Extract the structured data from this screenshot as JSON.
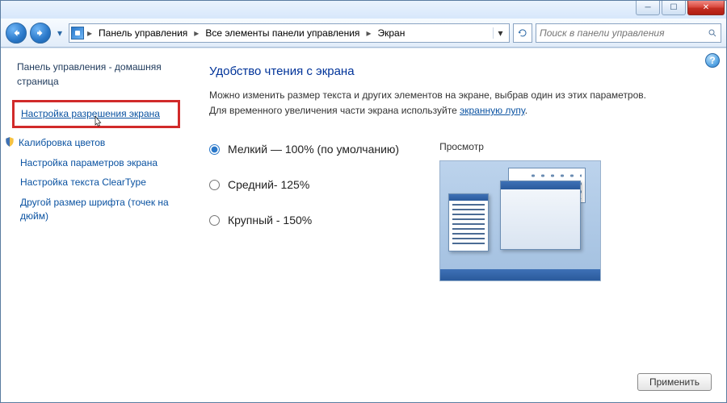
{
  "breadcrumb": {
    "items": [
      "Панель управления",
      "Все элементы панели управления",
      "Экран"
    ]
  },
  "search": {
    "placeholder": "Поиск в панели управления"
  },
  "sidebar": {
    "home": "Панель управления - домашняя страница",
    "items": [
      "Настройка разрешения экрана",
      "Калибровка цветов",
      "Настройка параметров экрана",
      "Настройка текста ClearType",
      "Другой размер шрифта (точек на дюйм)"
    ]
  },
  "content": {
    "heading": "Удобство чтения с экрана",
    "desc_before": "Можно изменить размер текста и других элементов на экране, выбрав один из этих параметров. Для временного увеличения части экрана используйте ",
    "desc_link": "экранную лупу",
    "desc_after": ".",
    "options": [
      "Мелкий — 100% (по умолчанию)",
      "Средний- 125%",
      "Крупный - 150%"
    ],
    "preview_label": "Просмотр",
    "apply_label": "Применить"
  }
}
